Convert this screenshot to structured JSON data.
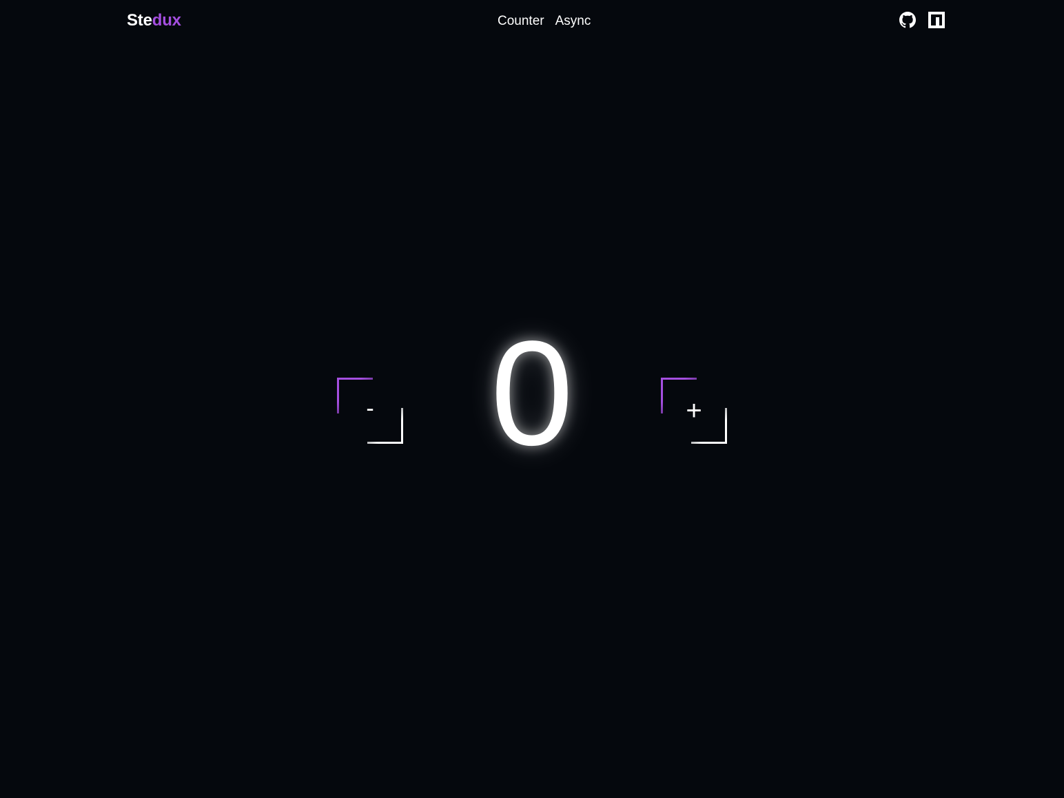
{
  "header": {
    "logo_part1": "Ste",
    "logo_part2": "dux",
    "nav": [
      {
        "label": "Counter"
      },
      {
        "label": "Async"
      }
    ],
    "icons": [
      "github-icon",
      "npm-icon"
    ]
  },
  "counter": {
    "value": "0",
    "decrement_label": "-",
    "increment_label": "+"
  },
  "colors": {
    "background": "#05080d",
    "accent": "#a54fe0",
    "text": "#ffffff"
  }
}
